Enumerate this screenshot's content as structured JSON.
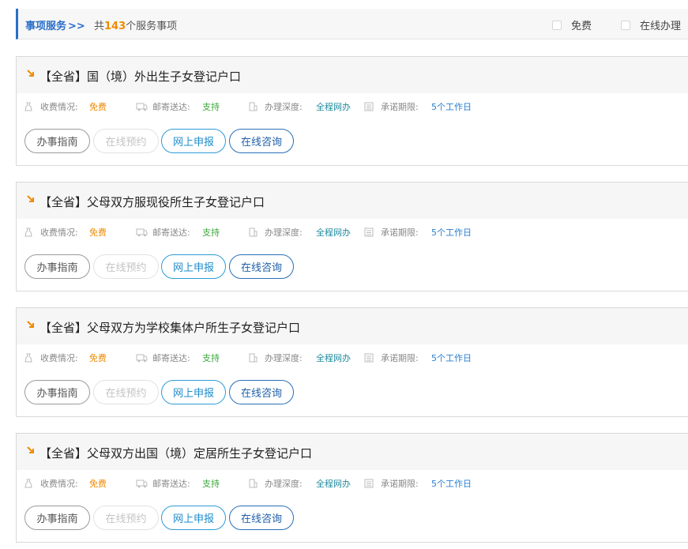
{
  "header": {
    "breadcrumb": "事项服务",
    "breadcrumb_arrows": ">>",
    "count_prefix": "共",
    "count": "143",
    "count_suffix": "个服务事项",
    "filters": [
      {
        "label": "免费",
        "checked": false
      },
      {
        "label": "在线办理",
        "checked": false
      }
    ]
  },
  "meta_labels": {
    "fee": "收费情况:",
    "mail": "邮寄送达:",
    "depth": "办理深度:",
    "deadline": "承诺期限:"
  },
  "buttons": {
    "guide": "办事指南",
    "reserve": "在线预约",
    "apply": "网上申报",
    "consult": "在线咨询"
  },
  "colors": {
    "accent_blue": "#2a6fc9",
    "count_orange": "#f08a00",
    "fee_orange": "#f08a00",
    "mail_green": "#3aa63a",
    "depth_teal": "#1d8a9e",
    "deadline_blue": "#2a7fd0"
  },
  "items": [
    {
      "title": "【全省】国（境）外出生子女登记户口",
      "fee": "免费",
      "mail": "支持",
      "depth": "全程网办",
      "deadline": "5个工作日"
    },
    {
      "title": "【全省】父母双方服现役所生子女登记户口",
      "fee": "免费",
      "mail": "支持",
      "depth": "全程网办",
      "deadline": "5个工作日"
    },
    {
      "title": "【全省】父母双方为学校集体户所生子女登记户口",
      "fee": "免费",
      "mail": "支持",
      "depth": "全程网办",
      "deadline": "5个工作日"
    },
    {
      "title": "【全省】父母双方出国（境）定居所生子女登记户口",
      "fee": "免费",
      "mail": "支持",
      "depth": "全程网办",
      "deadline": "5个工作日"
    }
  ]
}
